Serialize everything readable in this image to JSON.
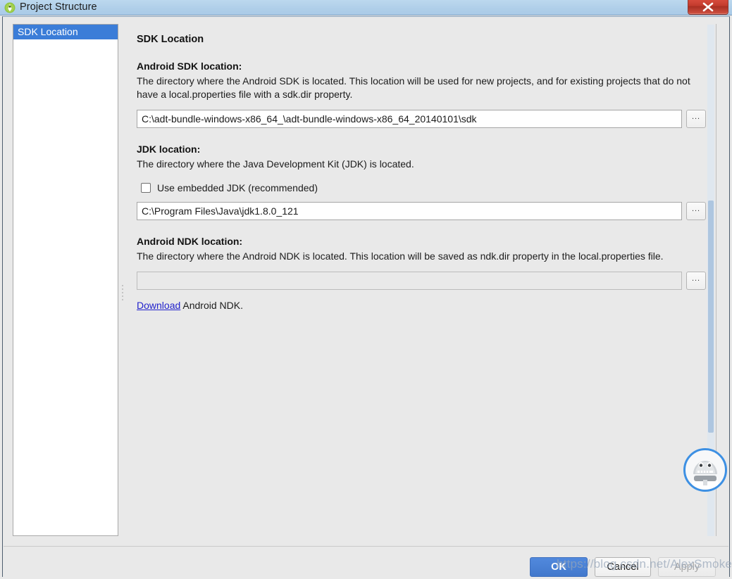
{
  "window": {
    "title": "Project Structure",
    "app_icon": "android-studio-icon",
    "close_label": "close-icon"
  },
  "sidebar": {
    "items": [
      {
        "label": "SDK Location",
        "selected": true
      }
    ]
  },
  "content": {
    "panel_title": "SDK Location",
    "sdk": {
      "heading": "Android SDK location:",
      "description": "The directory where the Android SDK is located. This location will be used for new projects, and for existing projects that do not have a local.properties file with a sdk.dir property.",
      "value": "C:\\adt-bundle-windows-x86_64_\\adt-bundle-windows-x86_64_20140101\\sdk",
      "placeholder": "",
      "browse_label": "..."
    },
    "jdk": {
      "heading": "JDK location:",
      "description": "The directory where the Java Development Kit (JDK) is located.",
      "checkbox_label": "Use embedded JDK (recommended)",
      "checkbox_checked": false,
      "value": "C:\\Program Files\\Java\\jdk1.8.0_121",
      "placeholder": "",
      "browse_label": "..."
    },
    "ndk": {
      "heading": "Android NDK location:",
      "description": "The directory where the Android NDK is located. This location will be saved as ndk.dir property in the local.properties file.",
      "value": "",
      "placeholder": "",
      "browse_label": "...",
      "link_text": "Download",
      "link_suffix": " Android NDK."
    }
  },
  "assistant": {
    "name": "assistant-robot-avatar"
  },
  "buttons": {
    "ok": "OK",
    "cancel": "Cancel",
    "apply": "Apply"
  },
  "watermark": {
    "text": "https://blog.csdn.net/AlexSmoker"
  },
  "colors": {
    "titlebar": "#b0cfe9",
    "selection": "#3b7dd8",
    "accent_button": "#4278cc",
    "link": "#2222cc",
    "close_button": "#c23b2d",
    "avatar_ring": "#3d90e3"
  }
}
